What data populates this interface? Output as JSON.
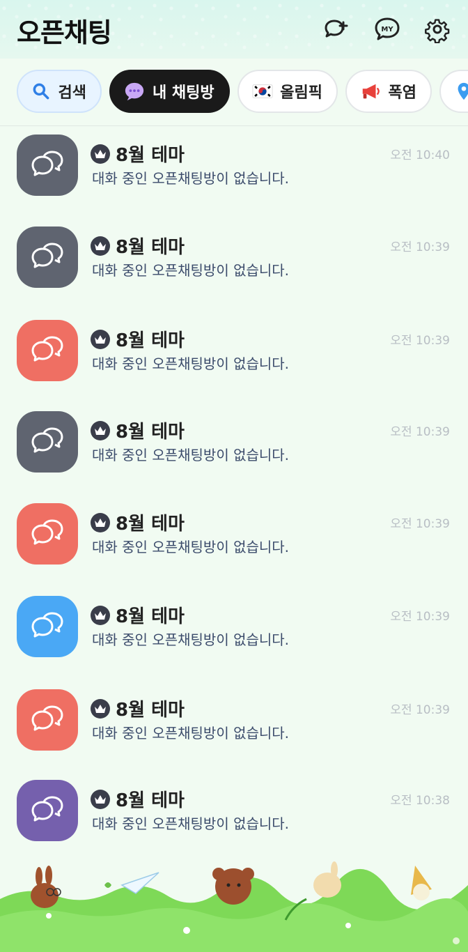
{
  "header": {
    "title": "오픈채팅",
    "icons": [
      "add-chat-icon",
      "my-profile-icon",
      "settings-icon"
    ],
    "my_label": "MY"
  },
  "chips": [
    {
      "label": "검색",
      "icon": "search-icon",
      "active": false
    },
    {
      "label": "내 채팅방",
      "icon": "chat-bubble-icon",
      "active": true
    },
    {
      "label": "올림픽",
      "icon": "korea-flag-icon",
      "active": false
    },
    {
      "label": "폭염",
      "icon": "megaphone-icon",
      "active": false
    },
    {
      "label": "",
      "icon": "location-pin-icon",
      "active": false
    }
  ],
  "rooms": [
    {
      "title": "8월 테마",
      "subtitle": "대화 중인 오픈채팅방이 없습니다.",
      "time": "오전 10:40",
      "color": "#5f6470"
    },
    {
      "title": "8월 테마",
      "subtitle": "대화 중인 오픈채팅방이 없습니다.",
      "time": "오전 10:39",
      "color": "#5f6470"
    },
    {
      "title": "8월 테마",
      "subtitle": "대화 중인 오픈채팅방이 없습니다.",
      "time": "오전 10:39",
      "color": "#ef6f63"
    },
    {
      "title": "8월 테마",
      "subtitle": "대화 중인 오픈채팅방이 없습니다.",
      "time": "오전 10:39",
      "color": "#5f6470"
    },
    {
      "title": "8월 테마",
      "subtitle": "대화 중인 오픈채팅방이 없습니다.",
      "time": "오전 10:39",
      "color": "#ef6f63"
    },
    {
      "title": "8월 테마",
      "subtitle": "대화 중인 오픈채팅방이 없습니다.",
      "time": "오전 10:39",
      "color": "#4aa8f5"
    },
    {
      "title": "8월 테마",
      "subtitle": "대화 중인 오픈채팅방이 없습니다.",
      "time": "오전 10:39",
      "color": "#ef6f63"
    },
    {
      "title": "8월 테마",
      "subtitle": "대화 중인 오픈채팅방이 없습니다.",
      "time": "오전 10:38",
      "color": "#7560ad"
    }
  ],
  "colors": {
    "background": "#f1fbf2",
    "active_chip": "#1a1a1a",
    "grass": "#7ed957"
  }
}
